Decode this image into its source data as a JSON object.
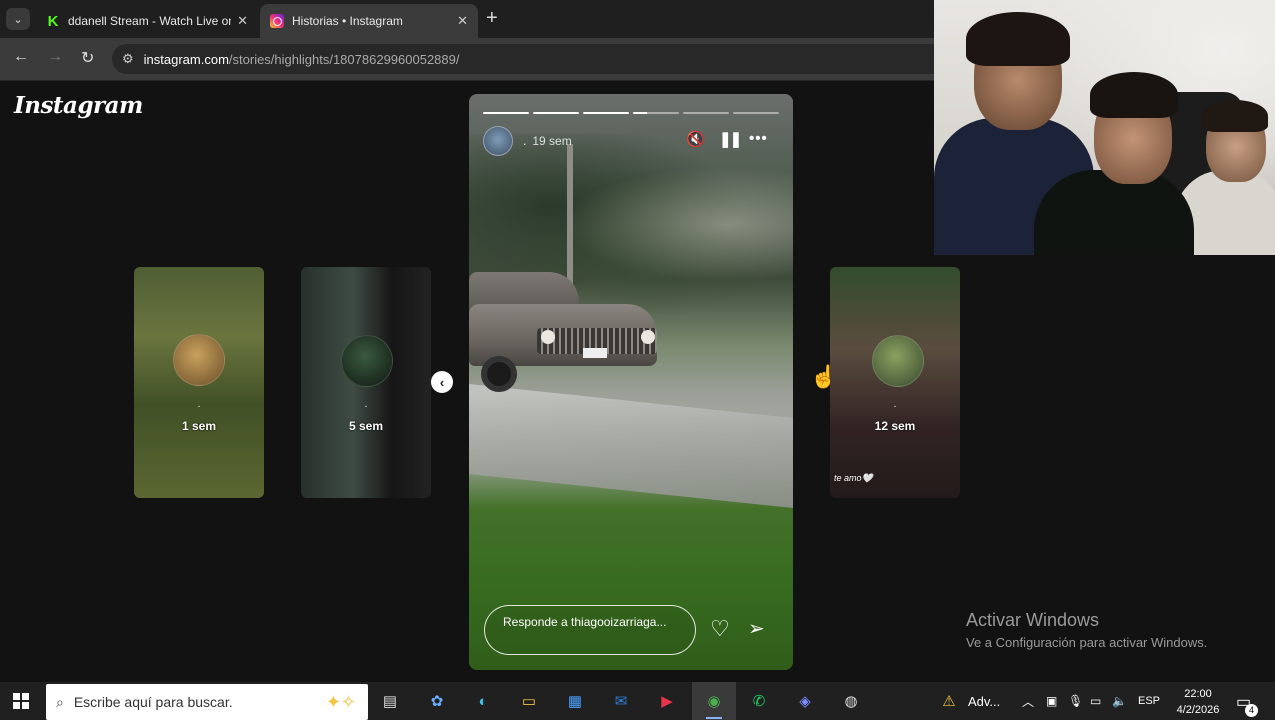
{
  "browser": {
    "tabs": [
      {
        "title": "ddanell Stream - Watch Live on",
        "icon": "kick-favicon"
      },
      {
        "title": "Historias • Instagram",
        "icon": "instagram-favicon"
      }
    ],
    "new_tab": "+",
    "url_host": "instagram.com",
    "url_path": "/stories/highlights/18078629960052889/"
  },
  "instagram": {
    "logo": "Instagram",
    "side_stories": [
      {
        "user": ".",
        "time": "1 sem"
      },
      {
        "user": ".",
        "time": "5 sem"
      },
      {
        "user": ".",
        "time": "12 sem",
        "caption": "te amo🤍"
      }
    ],
    "main_story": {
      "user": ".",
      "time": "19 sem",
      "progress": [
        1,
        1,
        1,
        0.3,
        0,
        0
      ],
      "reply_placeholder": "Responde a thiagooizarriaga...",
      "controls": {
        "mute": "🔇",
        "pause": "❚❚",
        "more": "•••"
      }
    }
  },
  "windows": {
    "watermark_title": "Activar Windows",
    "watermark_sub": "Ve a Configuración para activar Windows."
  },
  "taskbar": {
    "search_placeholder": "Escribe aquí para buscar.",
    "weather": "Adv...",
    "language": "ESP",
    "time": "22:00",
    "date": "4/2/2026",
    "notifications": "4"
  }
}
